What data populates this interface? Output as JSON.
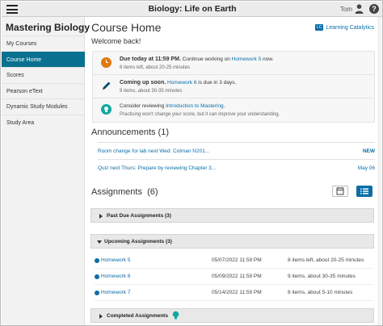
{
  "topbar": {
    "course_title": "Biology: Life on Earth",
    "user_name": "Tom",
    "help_label": "?"
  },
  "sidebar": {
    "brand": "Mastering Biology",
    "items": [
      {
        "label": "My Courses"
      },
      {
        "label": "Course Home",
        "active": true
      },
      {
        "label": "Scores"
      },
      {
        "label": "Pearson eText"
      },
      {
        "label": "Dynamic Study Modules"
      },
      {
        "label": "Study Area"
      }
    ]
  },
  "main": {
    "title": "Course Home",
    "welcome": "Welcome back!",
    "learning_catalytics": {
      "badge": "LC",
      "label": "Learning Catalytics"
    },
    "todos": [
      {
        "icon": "clock-icon",
        "head_bold": "Due today at 11:59 PM.",
        "head_pre": " Continue working on ",
        "head_link": "Homework 5",
        "head_post": " now.",
        "sub": "8 items left, about 20-25 minutes"
      },
      {
        "icon": "pencil-icon",
        "head_bold": "Coming up soon.",
        "head_pre": " ",
        "head_link": "Homework 6",
        "head_post": " is due in 3 days.",
        "sub": "9 items, about 30-35 minutes"
      },
      {
        "icon": "lightbulb-icon",
        "head_bold": "",
        "head_pre": "Consider reviewing ",
        "head_link": "Introduction to Mastering",
        "head_post": ".",
        "sub": "Practicing won't change your score, but it can improve your understanding."
      }
    ],
    "announcements": {
      "title": "Announcements (1)",
      "items": [
        {
          "title": "Room change for lab next Wed: Colman N201...",
          "right": "NEW"
        },
        {
          "title": "Quiz next Thurs: Prepare by reviewing Chapter 3...",
          "right": "May 06"
        }
      ]
    },
    "assignments": {
      "title": "Assignments",
      "count": "(6)",
      "groups": {
        "past_due": "Past Due Assignments (3)",
        "upcoming": "Upcoming Assignments (3)",
        "completed": "Completed Assignments"
      },
      "upcoming_items": [
        {
          "name": "Homework 5",
          "due": "05/07/2022 11:59 PM",
          "status": "8 items left, about 20-25 minutes"
        },
        {
          "name": "Homework 6",
          "due": "05/09/2022 11:59 PM",
          "status": "9 items, about 30-35 minutes"
        },
        {
          "name": "Homework 7",
          "due": "05/14/2022 11:59 PM",
          "status": "8 items, about 5-10 minutes"
        }
      ]
    }
  },
  "colors": {
    "accent": "#0a7191",
    "link": "#0a6ea8",
    "due_today": "#e07a10",
    "tip": "#13a8a0"
  }
}
